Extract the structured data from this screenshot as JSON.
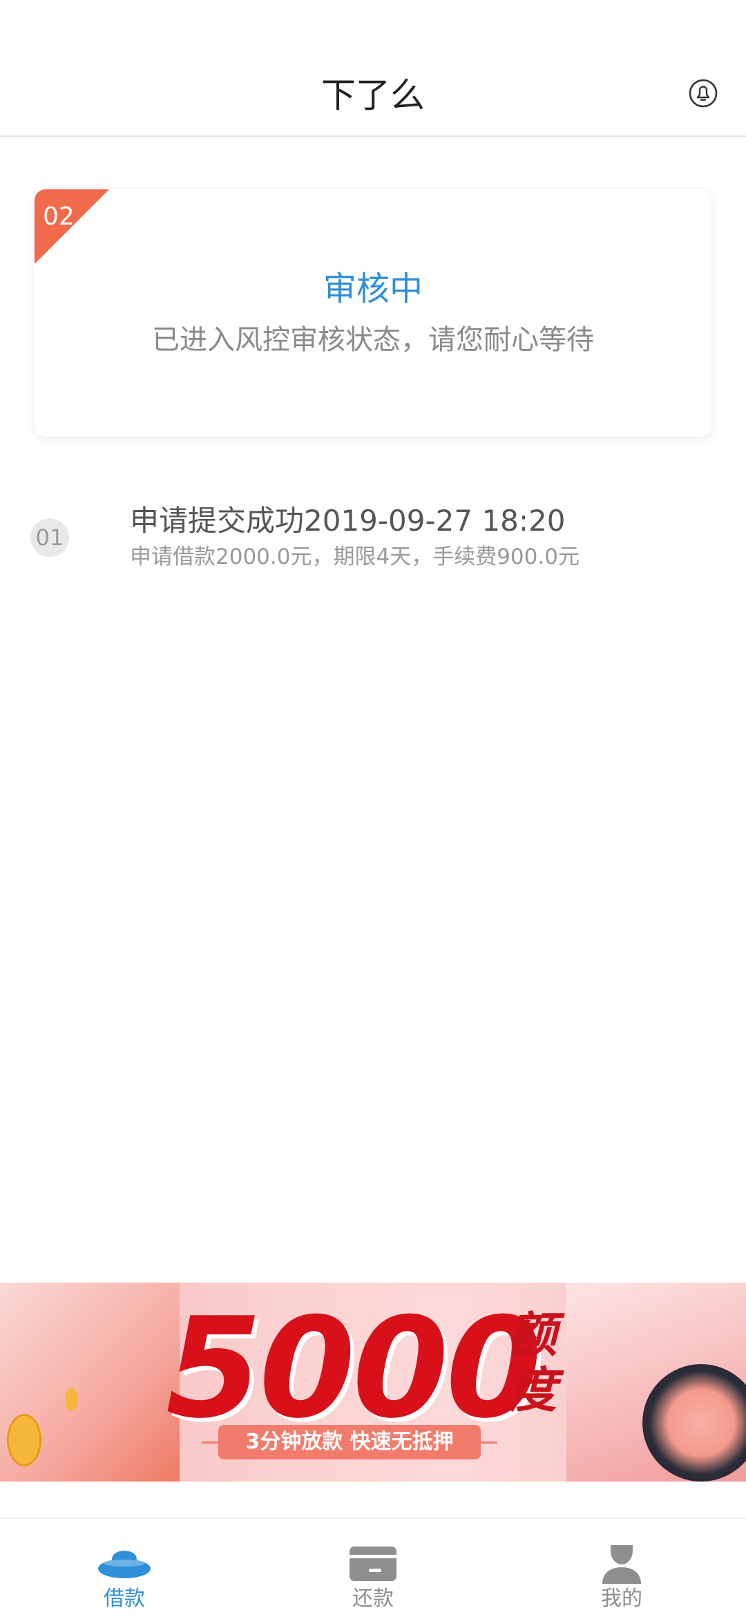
{
  "header": {
    "title": "下了么",
    "notification_icon": "bell-icon"
  },
  "status_card": {
    "step": "02",
    "title": "审核中",
    "subtitle": "已进入风控审核状态，请您耐心等待"
  },
  "timeline": [
    {
      "step": "01",
      "title": "申请提交成功2019-09-27 18:20",
      "detail": "申请借款2000.0元，期限4天，手续费900.0元"
    }
  ],
  "banner": {
    "amount": "5000",
    "unit": "额度",
    "tagline": "3分钟放款 快速无抵押"
  },
  "tabbar": {
    "items": [
      {
        "label": "借款",
        "icon": "ingot-icon",
        "active": true
      },
      {
        "label": "还款",
        "icon": "card-icon",
        "active": false
      },
      {
        "label": "我的",
        "icon": "user-icon",
        "active": false
      }
    ]
  },
  "colors": {
    "accent": "#2f8fd8",
    "ribbon": "#f26a4c",
    "banner_red": "#d7101a",
    "inactive": "#8e8e8e"
  }
}
